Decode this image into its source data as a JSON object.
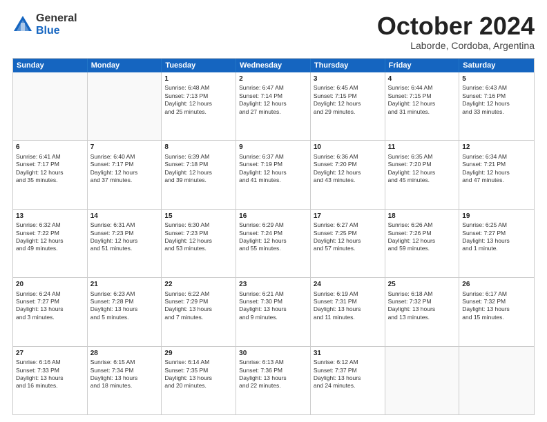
{
  "logo": {
    "general": "General",
    "blue": "Blue"
  },
  "header": {
    "month": "October 2024",
    "location": "Laborde, Cordoba, Argentina"
  },
  "days": [
    "Sunday",
    "Monday",
    "Tuesday",
    "Wednesday",
    "Thursday",
    "Friday",
    "Saturday"
  ],
  "rows": [
    [
      {
        "day": "",
        "empty": true
      },
      {
        "day": "",
        "empty": true
      },
      {
        "day": "1",
        "lines": [
          "Sunrise: 6:48 AM",
          "Sunset: 7:13 PM",
          "Daylight: 12 hours",
          "and 25 minutes."
        ]
      },
      {
        "day": "2",
        "lines": [
          "Sunrise: 6:47 AM",
          "Sunset: 7:14 PM",
          "Daylight: 12 hours",
          "and 27 minutes."
        ]
      },
      {
        "day": "3",
        "lines": [
          "Sunrise: 6:45 AM",
          "Sunset: 7:15 PM",
          "Daylight: 12 hours",
          "and 29 minutes."
        ]
      },
      {
        "day": "4",
        "lines": [
          "Sunrise: 6:44 AM",
          "Sunset: 7:15 PM",
          "Daylight: 12 hours",
          "and 31 minutes."
        ]
      },
      {
        "day": "5",
        "lines": [
          "Sunrise: 6:43 AM",
          "Sunset: 7:16 PM",
          "Daylight: 12 hours",
          "and 33 minutes."
        ]
      }
    ],
    [
      {
        "day": "6",
        "lines": [
          "Sunrise: 6:41 AM",
          "Sunset: 7:17 PM",
          "Daylight: 12 hours",
          "and 35 minutes."
        ]
      },
      {
        "day": "7",
        "lines": [
          "Sunrise: 6:40 AM",
          "Sunset: 7:17 PM",
          "Daylight: 12 hours",
          "and 37 minutes."
        ]
      },
      {
        "day": "8",
        "lines": [
          "Sunrise: 6:39 AM",
          "Sunset: 7:18 PM",
          "Daylight: 12 hours",
          "and 39 minutes."
        ]
      },
      {
        "day": "9",
        "lines": [
          "Sunrise: 6:37 AM",
          "Sunset: 7:19 PM",
          "Daylight: 12 hours",
          "and 41 minutes."
        ]
      },
      {
        "day": "10",
        "lines": [
          "Sunrise: 6:36 AM",
          "Sunset: 7:20 PM",
          "Daylight: 12 hours",
          "and 43 minutes."
        ]
      },
      {
        "day": "11",
        "lines": [
          "Sunrise: 6:35 AM",
          "Sunset: 7:20 PM",
          "Daylight: 12 hours",
          "and 45 minutes."
        ]
      },
      {
        "day": "12",
        "lines": [
          "Sunrise: 6:34 AM",
          "Sunset: 7:21 PM",
          "Daylight: 12 hours",
          "and 47 minutes."
        ]
      }
    ],
    [
      {
        "day": "13",
        "lines": [
          "Sunrise: 6:32 AM",
          "Sunset: 7:22 PM",
          "Daylight: 12 hours",
          "and 49 minutes."
        ]
      },
      {
        "day": "14",
        "lines": [
          "Sunrise: 6:31 AM",
          "Sunset: 7:23 PM",
          "Daylight: 12 hours",
          "and 51 minutes."
        ]
      },
      {
        "day": "15",
        "lines": [
          "Sunrise: 6:30 AM",
          "Sunset: 7:23 PM",
          "Daylight: 12 hours",
          "and 53 minutes."
        ]
      },
      {
        "day": "16",
        "lines": [
          "Sunrise: 6:29 AM",
          "Sunset: 7:24 PM",
          "Daylight: 12 hours",
          "and 55 minutes."
        ]
      },
      {
        "day": "17",
        "lines": [
          "Sunrise: 6:27 AM",
          "Sunset: 7:25 PM",
          "Daylight: 12 hours",
          "and 57 minutes."
        ]
      },
      {
        "day": "18",
        "lines": [
          "Sunrise: 6:26 AM",
          "Sunset: 7:26 PM",
          "Daylight: 12 hours",
          "and 59 minutes."
        ]
      },
      {
        "day": "19",
        "lines": [
          "Sunrise: 6:25 AM",
          "Sunset: 7:27 PM",
          "Daylight: 13 hours",
          "and 1 minute."
        ]
      }
    ],
    [
      {
        "day": "20",
        "lines": [
          "Sunrise: 6:24 AM",
          "Sunset: 7:27 PM",
          "Daylight: 13 hours",
          "and 3 minutes."
        ]
      },
      {
        "day": "21",
        "lines": [
          "Sunrise: 6:23 AM",
          "Sunset: 7:28 PM",
          "Daylight: 13 hours",
          "and 5 minutes."
        ]
      },
      {
        "day": "22",
        "lines": [
          "Sunrise: 6:22 AM",
          "Sunset: 7:29 PM",
          "Daylight: 13 hours",
          "and 7 minutes."
        ]
      },
      {
        "day": "23",
        "lines": [
          "Sunrise: 6:21 AM",
          "Sunset: 7:30 PM",
          "Daylight: 13 hours",
          "and 9 minutes."
        ]
      },
      {
        "day": "24",
        "lines": [
          "Sunrise: 6:19 AM",
          "Sunset: 7:31 PM",
          "Daylight: 13 hours",
          "and 11 minutes."
        ]
      },
      {
        "day": "25",
        "lines": [
          "Sunrise: 6:18 AM",
          "Sunset: 7:32 PM",
          "Daylight: 13 hours",
          "and 13 minutes."
        ]
      },
      {
        "day": "26",
        "lines": [
          "Sunrise: 6:17 AM",
          "Sunset: 7:32 PM",
          "Daylight: 13 hours",
          "and 15 minutes."
        ]
      }
    ],
    [
      {
        "day": "27",
        "lines": [
          "Sunrise: 6:16 AM",
          "Sunset: 7:33 PM",
          "Daylight: 13 hours",
          "and 16 minutes."
        ]
      },
      {
        "day": "28",
        "lines": [
          "Sunrise: 6:15 AM",
          "Sunset: 7:34 PM",
          "Daylight: 13 hours",
          "and 18 minutes."
        ]
      },
      {
        "day": "29",
        "lines": [
          "Sunrise: 6:14 AM",
          "Sunset: 7:35 PM",
          "Daylight: 13 hours",
          "and 20 minutes."
        ]
      },
      {
        "day": "30",
        "lines": [
          "Sunrise: 6:13 AM",
          "Sunset: 7:36 PM",
          "Daylight: 13 hours",
          "and 22 minutes."
        ]
      },
      {
        "day": "31",
        "lines": [
          "Sunrise: 6:12 AM",
          "Sunset: 7:37 PM",
          "Daylight: 13 hours",
          "and 24 minutes."
        ]
      },
      {
        "day": "",
        "empty": true
      },
      {
        "day": "",
        "empty": true
      }
    ]
  ]
}
